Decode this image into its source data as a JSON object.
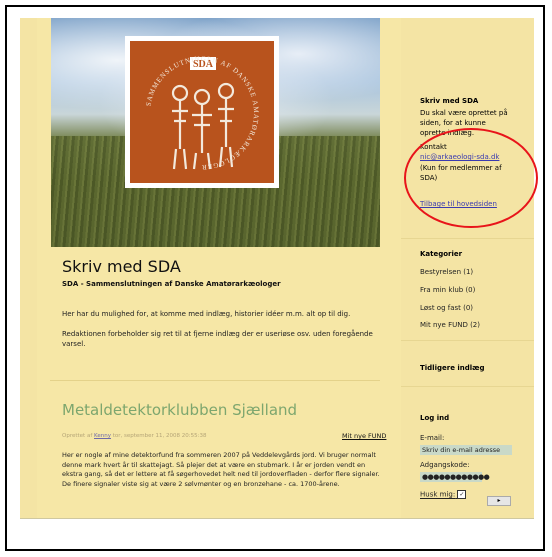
{
  "site": {
    "header_logo_text": "SDA",
    "header_logo_ring": "SAMMENSLUTNINGEN AF DANSKE AMATØRARKÆOLOGER"
  },
  "main": {
    "title": "Skriv med SDA",
    "subtitle": "SDA - Sammenslutningen af Danske Amatørarkæologer",
    "para1": "Her har du mulighed for, at komme med indlæg, historier idéer m.m. alt op til dig.",
    "para2": "Redaktionen forbeholder sig ret til at fjerne indlæg der er useriøse osv. uden foregående varsel."
  },
  "post": {
    "title": "Metaldetektorklubben Sjælland",
    "meta_prefix": "Oprettet af",
    "meta_author": "Kenny",
    "meta_date": "tor, september 11, 2008 20:55:38",
    "category_link": "Mit nye FUND",
    "body": "Her er nogle af mine detektorfund fra sommeren 2007 på Veddelevgårds jord. Vi bruger normalt denne mark hvert år til skattejagt. Så plejer det at være en stubmark. I år er jorden vendt en ekstra gang, så det er lettere at få søgerhovedet helt ned til jordoverfladen - derfor flere signaler. De finere signaler viste sig at være 2 sølvmønter og en bronzehane - ca. 1700-årene."
  },
  "sidebar": {
    "skriv_heading": "Skriv med SDA",
    "skriv_text": "Du skal være oprettet på siden, for at kunne oprette indlæg.",
    "kontakt_label": "Kontakt",
    "kontakt_email": "nic@arkaeologi-sda.dk",
    "kontakt_note": "(Kun for medlemmer af SDA)",
    "back_link": "Tilbage til hovedsiden",
    "kategorier_heading": "Kategorier",
    "kategorier": [
      {
        "label": "Bestyrelsen (1)"
      },
      {
        "label": "Fra min klub (0)"
      },
      {
        "label": "Løst og fast (0)"
      },
      {
        "label": "Mit nye FUND (2)"
      }
    ],
    "tidligere_heading": "Tidligere indlæg",
    "login_heading": "Log ind",
    "email_label": "E-mail:",
    "email_placeholder": "Skriv din e-mail adresse",
    "password_label": "Adgangskode:",
    "password_value": "●●●●●●●●●●●●",
    "remember_label": "Husk mig:",
    "go_label": "▸"
  },
  "colors": {
    "page_bg": "#f4e4a4",
    "logo_orange": "#b8531d",
    "post_title_green": "#7da66e",
    "annotation_red": "#e8141a"
  }
}
